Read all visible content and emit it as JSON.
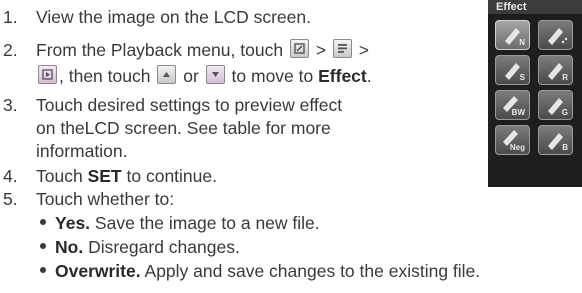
{
  "steps": [
    {
      "num": "1.",
      "text": "View the image on the LCD screen."
    },
    {
      "num": "2.",
      "parts": [
        "From the Playback menu, touch",
        ">",
        ">"
      ]
    },
    {
      "num": "",
      "parts": [
        ", then touch",
        "or",
        "to move to",
        "Effect",
        "."
      ]
    },
    {
      "num": "3.",
      "text": "Touch desired settings to preview effect"
    },
    {
      "num": "",
      "text": "on theLCD screen. See table for more"
    },
    {
      "num": "",
      "text": "information."
    },
    {
      "num": "4.",
      "parts": [
        "Touch",
        "SET",
        "to continue."
      ]
    },
    {
      "num": "5.",
      "text": "Touch whether to:"
    }
  ],
  "options": [
    {
      "label": "Yes.",
      "desc": "Save the image to a new file."
    },
    {
      "label": "No.",
      "desc": "Disregard changes."
    },
    {
      "label": "Overwrite.",
      "desc": "Apply and save changes to the existing file."
    }
  ],
  "lcd": {
    "title": "Effect",
    "tiles": [
      {
        "label": "N",
        "selected": true
      },
      {
        "label": "",
        "selected": false
      },
      {
        "label": "S",
        "selected": false
      },
      {
        "label": "R",
        "selected": false
      },
      {
        "label": "BW",
        "selected": false
      },
      {
        "label": "G",
        "selected": false
      },
      {
        "label": "Neg",
        "selected": false
      },
      {
        "label": "B",
        "selected": false
      }
    ]
  },
  "icons": [
    "edit-icon",
    "menu-icon",
    "playback-icon",
    "up-arrow-icon",
    "down-arrow-icon",
    "effect-pen-icon"
  ]
}
